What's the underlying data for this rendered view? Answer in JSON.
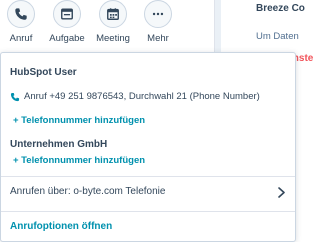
{
  "actions": [
    {
      "label": "Anruf",
      "icon": "phone-icon"
    },
    {
      "label": "Aufgabe",
      "icon": "task-icon"
    },
    {
      "label": "Meeting",
      "icon": "calendar-icon"
    },
    {
      "label": "Mehr",
      "icon": "more-icon"
    }
  ],
  "right_panel": {
    "title": "Breeze Co",
    "text": "Um Daten",
    "highlight": "KI-Einste"
  },
  "popover": {
    "user_title": "HubSpot User",
    "phone_entry": "Anruf +49 251 9876543, Durchwahl 21 (Phone Number)",
    "add_phone_label": "+ Telefonnummer hinzufügen",
    "company_title": "Unternehmen GmbH",
    "add_phone_label_company": "+ Telefonnummer hinzufügen",
    "call_via": "Anrufen über: o-byte.com Telefonie",
    "open_options": "Anrufoptionen öffnen"
  },
  "colors": {
    "link": "#0091ae",
    "text": "#33475b",
    "accent_red": "#f2545b"
  }
}
